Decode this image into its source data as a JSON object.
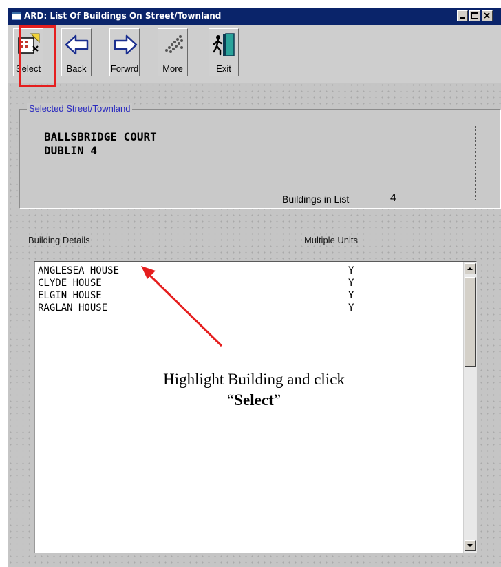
{
  "window": {
    "title": "ARD: List Of Buildings On Street/Townland",
    "controls": [
      "minimize",
      "maximize",
      "close"
    ]
  },
  "toolbar": {
    "buttons": [
      {
        "label": "Select",
        "icon": "select-building-icon"
      },
      {
        "label": "Back",
        "icon": "left-arrow-icon"
      },
      {
        "label": "Forwrd",
        "icon": "right-arrow-icon"
      },
      {
        "label": "More",
        "icon": "more-dots-icon"
      },
      {
        "label": "Exit",
        "icon": "exit-door-icon"
      }
    ]
  },
  "selected_street": {
    "legend": "Selected Street/Townland",
    "line1": "BALLSBRIDGE COURT",
    "line2": "DUBLIN 4",
    "count_label": "Buildings in List",
    "count_value": "4"
  },
  "building_list": {
    "header_details": "Building Details",
    "header_units": "Multiple Units",
    "rows": [
      {
        "name": "ANGLESEA HOUSE",
        "multiple_units": "Y"
      },
      {
        "name": "CLYDE HOUSE",
        "multiple_units": "Y"
      },
      {
        "name": "ELGIN HOUSE",
        "multiple_units": "Y"
      },
      {
        "name": "RAGLAN HOUSE",
        "multiple_units": "Y"
      }
    ]
  },
  "annotation": {
    "line1": "Highlight Building and click",
    "open_quote": "“",
    "select_word": "Select",
    "close_quote": "”"
  },
  "colors": {
    "title_bar": "#0a246a",
    "highlight_box": "#e51e1e",
    "legend_text": "#2b2bbf"
  }
}
